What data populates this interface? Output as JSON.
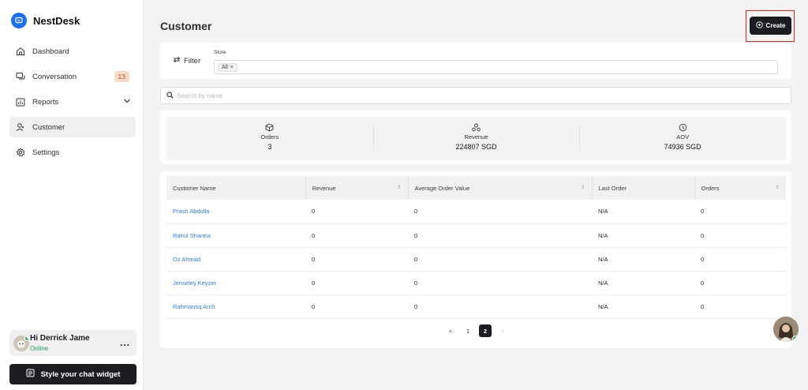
{
  "brand": {
    "name": "NestDesk"
  },
  "nav": [
    {
      "label": "Dashboard",
      "icon": "home-icon"
    },
    {
      "label": "Conversation",
      "icon": "chat-icon",
      "badge": "13"
    },
    {
      "label": "Reports",
      "icon": "reports-icon"
    },
    {
      "label": "Customer",
      "icon": "customer-icon",
      "active": true
    },
    {
      "label": "Settings",
      "icon": "gear-icon"
    }
  ],
  "user": {
    "name": "Hi Derrick Jame",
    "status": "Online",
    "more": "..."
  },
  "style_button": {
    "label": "Style your chat widget"
  },
  "page": {
    "title": "Customer"
  },
  "create_button": {
    "label": "Create"
  },
  "filter": {
    "label": "Filter",
    "store_label": "Store",
    "chip": "All",
    "chip_remove": "×"
  },
  "search": {
    "placeholder": "Search by name"
  },
  "stats": [
    {
      "label": "Orders",
      "value": "3",
      "icon": "box-icon"
    },
    {
      "label": "Revenue",
      "value": "224807 SGD",
      "icon": "revenue-icon"
    },
    {
      "label": "AOV",
      "value": "74936 SGD",
      "icon": "clock-icon"
    }
  ],
  "table": {
    "columns": [
      "Customer Name",
      "Revenue",
      "Average Order Value",
      "Last Order",
      "Orders"
    ],
    "rows": [
      [
        "Prash Abdulla",
        "0",
        "0",
        "N/A",
        "0"
      ],
      [
        "Rahul Sharma",
        "0",
        "0",
        "N/A",
        "0"
      ],
      [
        "Oz Ahmad",
        "0",
        "0",
        "N/A",
        "0"
      ],
      [
        "Jenseley Keyzer",
        "0",
        "0",
        "N/A",
        "0"
      ],
      [
        "Rahmansq Arch",
        "0",
        "0",
        "N/A",
        "0"
      ]
    ]
  },
  "pagination": {
    "prev": "<",
    "pages": [
      "1",
      "2"
    ],
    "next": ">",
    "current": "2"
  },
  "colors": {
    "accent": "#1d6ff2",
    "link": "#2d7ee5",
    "dark": "#1c1d20",
    "highlight": "#e02424",
    "online": "#21b15a"
  }
}
